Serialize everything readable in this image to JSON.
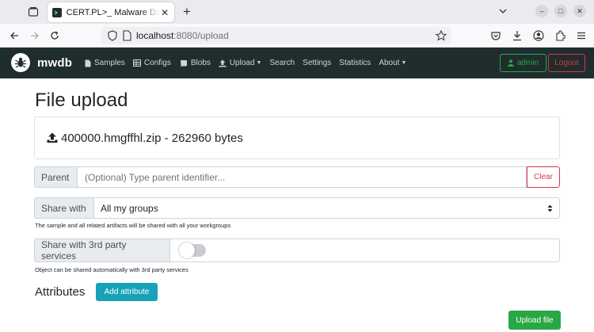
{
  "browser": {
    "tab_title": "CERT.PL>_ Malware Database",
    "url_host": "localhost",
    "url_rest": ":8080/upload",
    "new_tab": "+"
  },
  "nav": {
    "brand": "mwdb",
    "items": [
      {
        "label": "Samples",
        "icon": "file-icon"
      },
      {
        "label": "Configs",
        "icon": "table-icon"
      },
      {
        "label": "Blobs",
        "icon": "scroll-icon"
      },
      {
        "label": "Upload",
        "icon": "upload-icon",
        "dropdown": true
      },
      {
        "label": "Search"
      },
      {
        "label": "Settings"
      },
      {
        "label": "Statistics"
      },
      {
        "label": "About",
        "dropdown": true
      }
    ],
    "user": "admin",
    "logout": "Logout"
  },
  "page": {
    "title": "File upload",
    "file_info": "400000.hmgffhl.zip - 262960 bytes",
    "parent_label": "Parent",
    "parent_placeholder": "(Optional) Type parent identifier...",
    "clear": "Clear",
    "share_label": "Share with",
    "share_value": "All my groups",
    "share_help": "The sample and all related artifacts will be shared with all your workgroups",
    "third_party_label": "Share with 3rd party services",
    "third_party_enabled": false,
    "third_party_help": "Object can be shared automatically with 3rd party services",
    "attributes_label": "Attributes",
    "add_attribute": "Add attribute",
    "upload_file": "Upload file"
  },
  "colors": {
    "navbar": "#1f2d2f",
    "success": "#28a745",
    "danger": "#dc3545",
    "info": "#17a2b8"
  }
}
